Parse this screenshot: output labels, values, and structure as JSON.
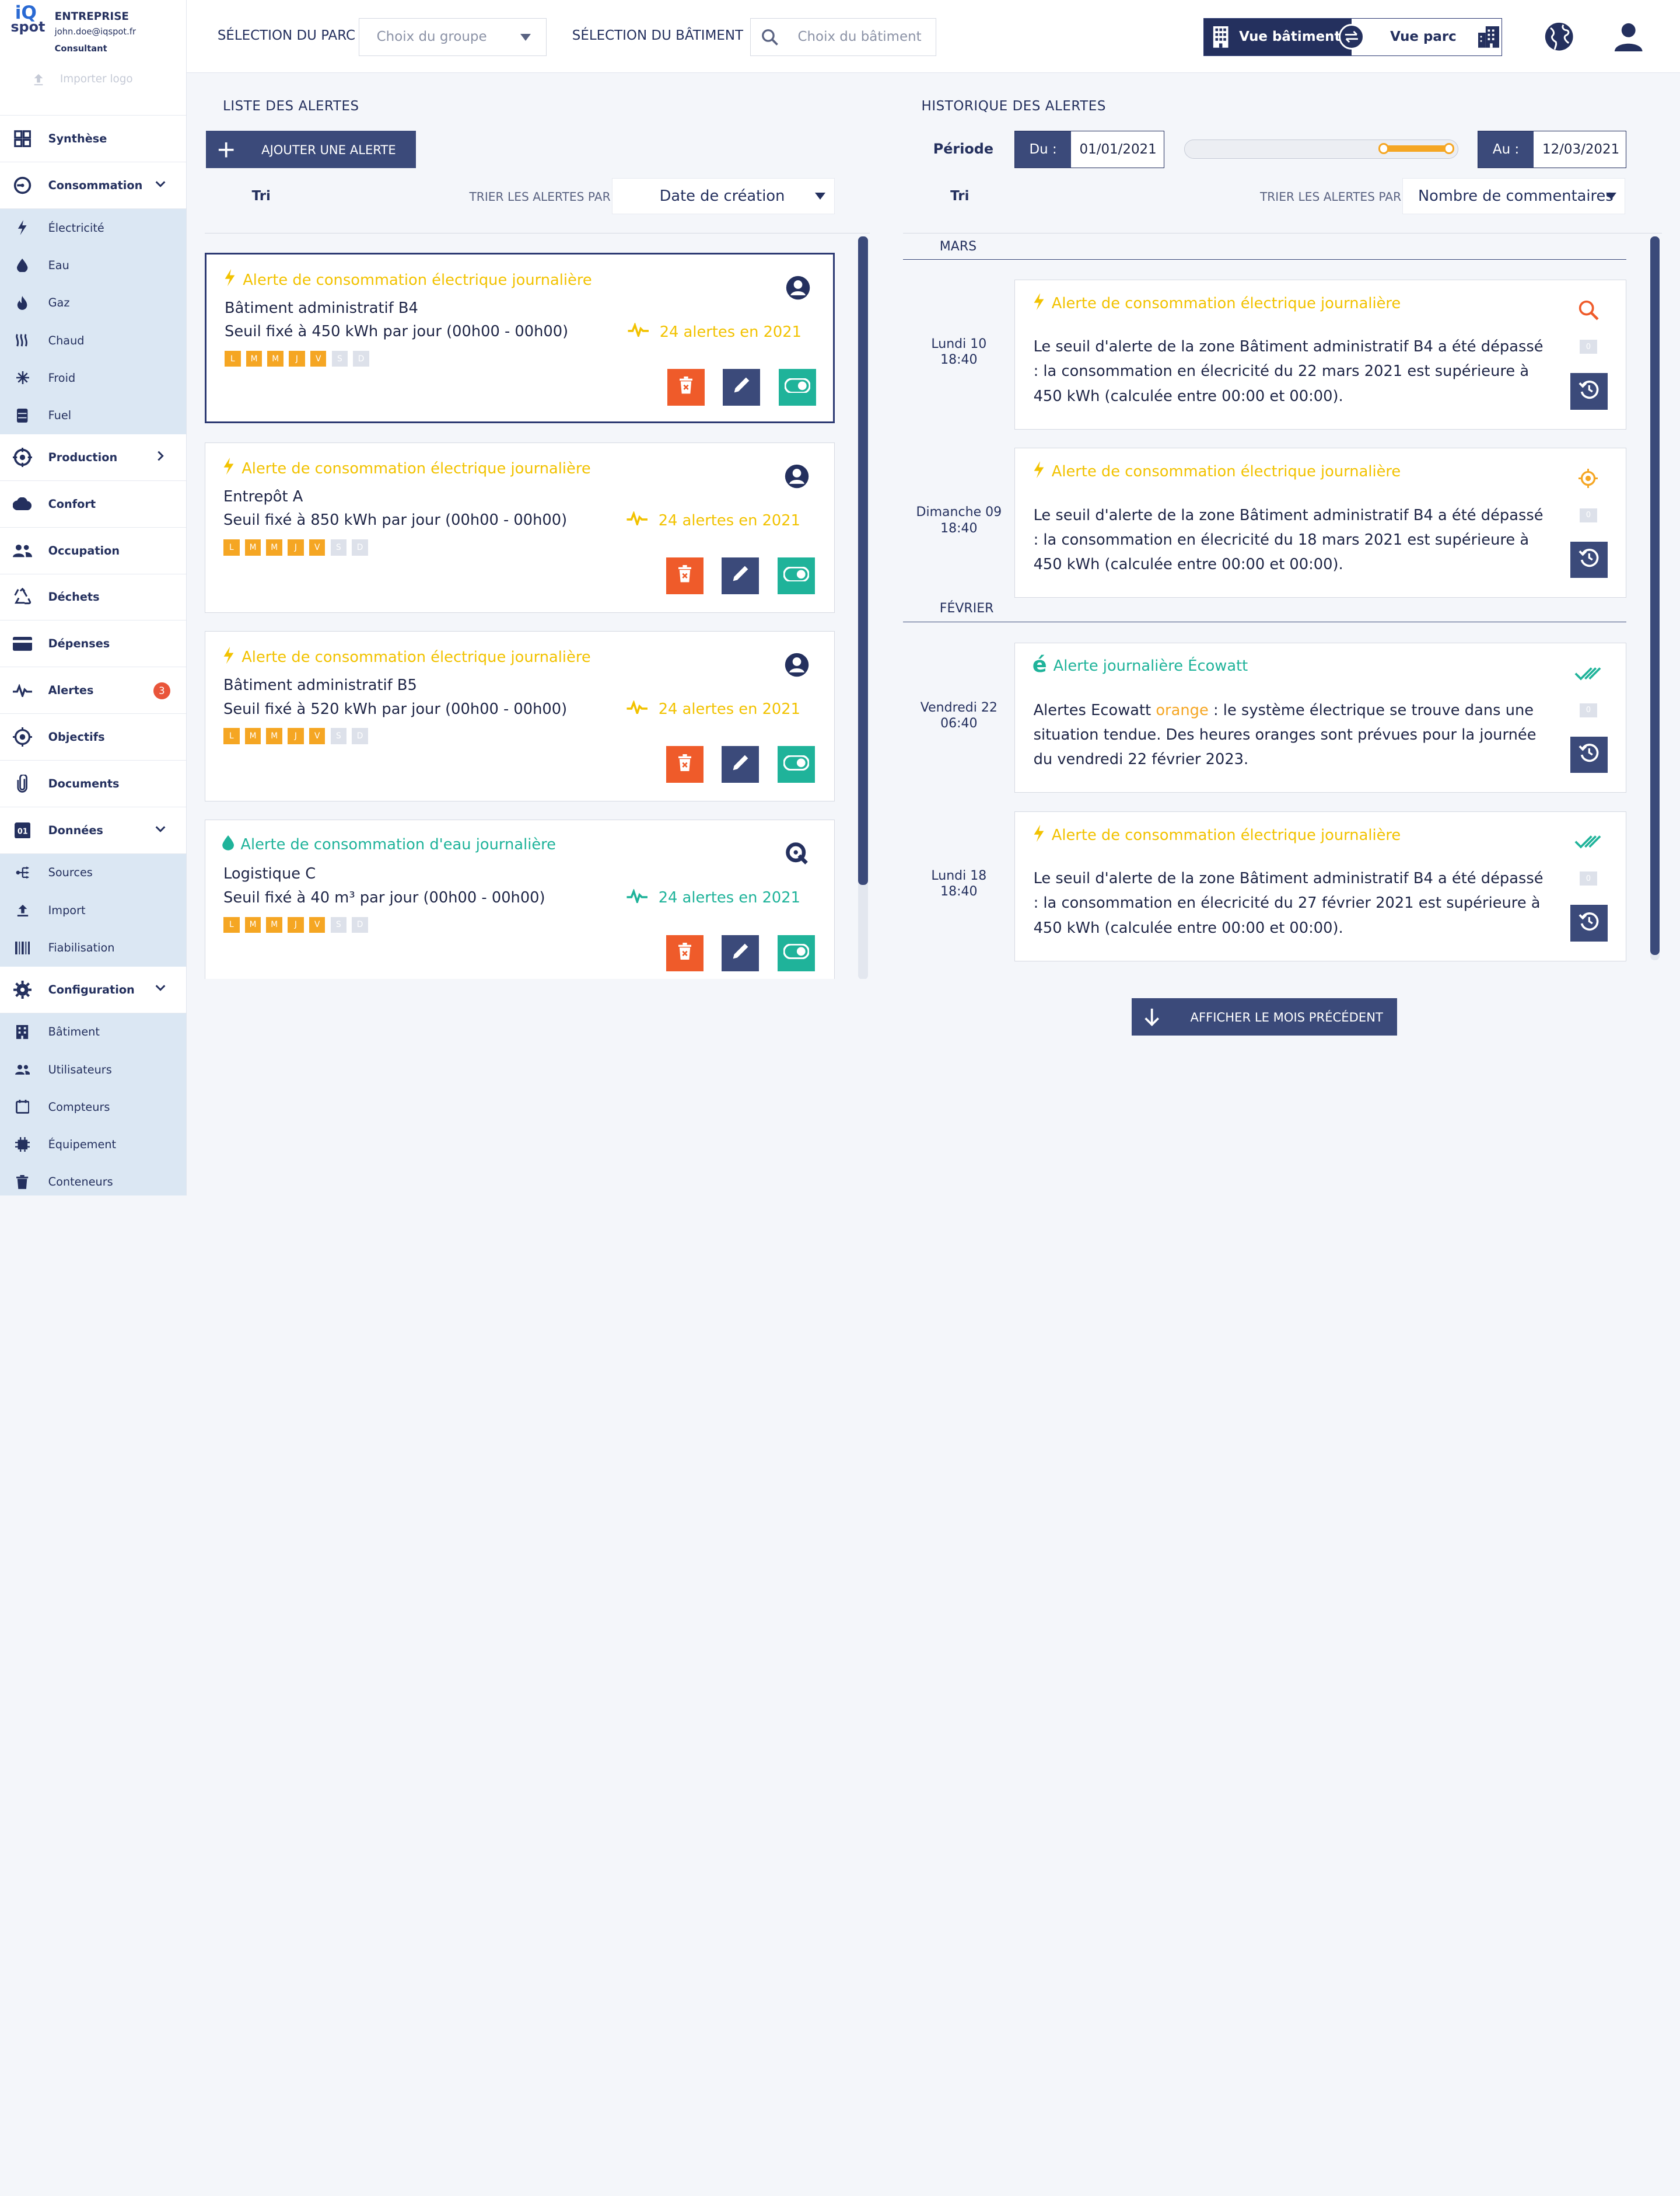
{
  "brand": {
    "logo_top": "iQ",
    "logo_bottom": "spot",
    "company": "ENTREPRISE",
    "email": "john.doe@iqspot.fr",
    "role": "Consultant",
    "import_logo": "Importer logo"
  },
  "sidebar": {
    "synthese": "Synthèse",
    "consommation": "Consommation",
    "conso_items": [
      "Électricité",
      "Eau",
      "Gaz",
      "Chaud",
      "Froid",
      "Fuel"
    ],
    "production": "Production",
    "confort": "Confort",
    "occupation": "Occupation",
    "dechets": "Déchets",
    "depenses": "Dépenses",
    "alertes": "Alertes",
    "alertes_badge": "3",
    "objectifs": "Objectifs",
    "documents": "Documents",
    "donnees": "Données",
    "donnees_items": [
      "Sources",
      "Import",
      "Fiabilisation"
    ],
    "configuration": "Configuration",
    "config_items": [
      "Bâtiment",
      "Utilisateurs",
      "Compteurs",
      "Équipement",
      "Conteneurs"
    ]
  },
  "topbar": {
    "parc_label": "SÉLECTION DU PARC",
    "parc_placeholder": "Choix du groupe",
    "batiment_label": "SÉLECTION DU BÂTIMENT",
    "batiment_placeholder": "Choix du bâtiment",
    "view_building": "Vue bâtiment",
    "view_park": "Vue parc"
  },
  "alert_list": {
    "title": "LISTE DES ALERTES",
    "add_button": "AJOUTER UNE ALERTE",
    "sort_title": "Tri",
    "sort_label": "TRIER LES ALERTES PAR",
    "sort_value": "Date de création",
    "days": [
      "L",
      "M",
      "M",
      "J",
      "V",
      "S",
      "D"
    ],
    "cards": [
      {
        "title": "Alerte de consommation électrique journalière",
        "name": "Bâtiment administratif B4",
        "threshold": "Seuil fixé à 450 kWh par jour (00h00 - 00h00)",
        "count": "24 alertes en 2021",
        "type": "elec",
        "owner": "user"
      },
      {
        "title": "Alerte de consommation électrique journalière",
        "name": "Entrepôt A",
        "threshold": "Seuil fixé à 850 kWh par jour (00h00 - 00h00)",
        "count": "24 alertes en 2021",
        "type": "elec",
        "owner": "user"
      },
      {
        "title": "Alerte de consommation électrique journalière",
        "name": "Bâtiment administratif B5",
        "threshold": "Seuil fixé à 520 kWh par jour (00h00 - 00h00)",
        "count": "24 alertes en 2021",
        "type": "elec",
        "owner": "user"
      },
      {
        "title": "Alerte de consommation d'eau journalière",
        "name": "Logistique C",
        "threshold": "Seuil fixé à 40 m³ par jour (00h00 - 00h00)",
        "count": "24 alertes en 2021",
        "type": "water",
        "owner": "iqspot"
      }
    ]
  },
  "history": {
    "title": "HISTORIQUE DES ALERTES",
    "period_label": "Période",
    "from_label": "Du :",
    "from_value": "01/01/2021",
    "to_label": "Au :",
    "to_value": "12/03/2021",
    "sort_title": "Tri",
    "sort_label": "TRIER LES ALERTES PAR",
    "sort_value": "Nombre de commentaires",
    "months": [
      "MARS",
      "FÉVRIER"
    ],
    "entries": [
      {
        "day": "Lundi 10",
        "time": "18:40",
        "title": "Alerte de consommation électrique journalière",
        "body": "Le seuil d'alerte de la zone Bâtiment administratif B4 a été dépassé : la consommation en élecricité du 22 mars 2021 est supérieure à 450 kWh (calculée entre 00:00 et 00:00).",
        "comments": "0",
        "status": "search"
      },
      {
        "day": "Dimanche 09",
        "time": "18:40",
        "title": "Alerte de consommation électrique journalière",
        "body": "Le seuil d'alerte de la zone Bâtiment administratif B4 a été dépassé : la consommation en élecricité du 18 mars 2021 est supérieure à 450 kWh (calculée entre 00:00 et 00:00).",
        "comments": "0",
        "status": "target"
      },
      {
        "day": "Vendredi 22",
        "time": "06:40",
        "title": "Alerte journalière Écowatt",
        "body_prefix": "Alertes Ecowatt ",
        "body_highlight": "orange",
        "body_suffix": " : le système électrique se trouve dans une situation tendue. Des heures oranges sont prévues pour la journée du vendredi 22 février 2023.",
        "comments": "0",
        "status": "done"
      },
      {
        "day": "Lundi 18",
        "time": "18:40",
        "title": "Alerte de consommation électrique journalière",
        "body": "Le seuil d'alerte de la zone Bâtiment administratif B4 a été dépassé : la consommation en élecricité du 27 février 2021 est supérieure à 450 kWh (calculée entre 00:00 et 00:00).",
        "comments": "0",
        "status": "done"
      }
    ],
    "prev_month_button": "AFFICHER LE MOIS PRÉCÉDENT"
  },
  "colors": {
    "navy": "#24305e",
    "elec": "#f2c200",
    "water": "#1fb39a",
    "delete": "#ef5b2a",
    "toggle": "#1fb39a",
    "badge": "#e9553a"
  }
}
